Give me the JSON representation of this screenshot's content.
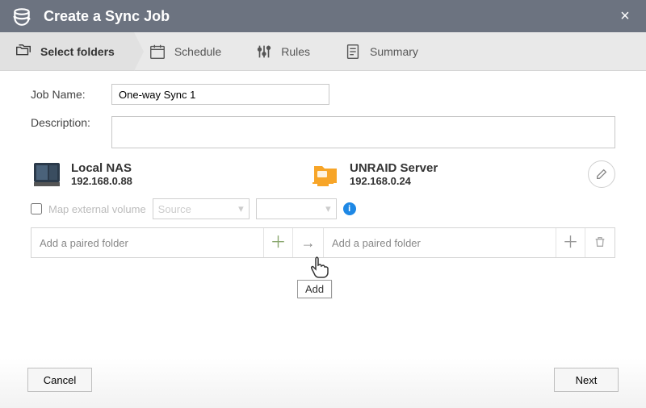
{
  "window": {
    "title": "Create a Sync Job"
  },
  "steps": {
    "select_folders": "Select folders",
    "schedule": "Schedule",
    "rules": "Rules",
    "summary": "Summary"
  },
  "form": {
    "job_name_label": "Job Name:",
    "job_name_value": "One-way Sync 1",
    "description_label": "Description:",
    "description_value": ""
  },
  "endpoints": {
    "source": {
      "name": "Local NAS",
      "addr": "192.168.0.88"
    },
    "dest": {
      "name": "UNRAID Server",
      "addr": "192.168.0.24"
    }
  },
  "map_external": {
    "label": "Map external volume",
    "source_placeholder": "Source",
    "target_placeholder": ""
  },
  "pair": {
    "source_placeholder": "Add a paired folder",
    "dest_placeholder": "Add a paired folder",
    "tooltip": "Add"
  },
  "footer": {
    "cancel": "Cancel",
    "next": "Next"
  }
}
